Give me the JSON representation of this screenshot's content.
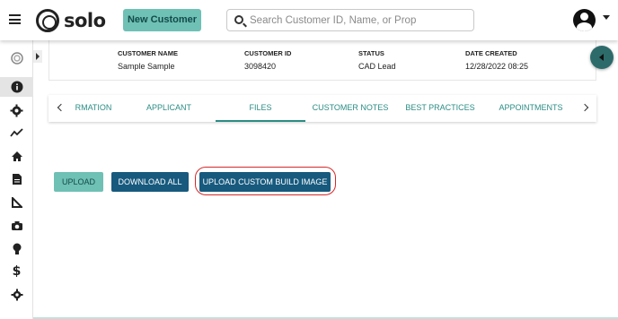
{
  "header": {
    "logo_text": "solo",
    "new_customer_label": "New Customer",
    "search_placeholder": "Search Customer ID, Name, or Prop",
    "search_value": ""
  },
  "sidebar": {
    "items": [
      {
        "icon": "target-icon"
      },
      {
        "icon": "info-icon",
        "active": true
      },
      {
        "icon": "gear-brain-icon"
      },
      {
        "icon": "trend-line-icon"
      },
      {
        "icon": "home-icon"
      },
      {
        "icon": "document-icon"
      },
      {
        "icon": "ruler-triangle-icon"
      },
      {
        "icon": "camera-icon"
      },
      {
        "icon": "lightbulb-icon"
      },
      {
        "icon": "dollar-icon"
      },
      {
        "icon": "settings-icon"
      }
    ]
  },
  "customer": {
    "name_label": "CUSTOMER NAME",
    "name_value": "Sample Sample",
    "id_label": "CUSTOMER ID",
    "id_value": "3098420",
    "status_label": "STATUS",
    "status_value": "CAD Lead",
    "date_label": "DATE CREATED",
    "date_value": "12/28/2022 08:25"
  },
  "tabs": [
    {
      "label": "RMATION"
    },
    {
      "label": "APPLICANT"
    },
    {
      "label": "FILES",
      "active": true
    },
    {
      "label": "CUSTOMER NOTES"
    },
    {
      "label": "BEST PRACTICES"
    },
    {
      "label": "APPOINTMENTS"
    }
  ],
  "files": {
    "upload_label": "UPLOAD",
    "download_all_label": "DOWNLOAD ALL",
    "upload_custom_label": "UPLOAD CUSTOM BUILD IMAGE"
  },
  "colors": {
    "teal_button": "#6fc0b5",
    "navy_button": "#175a7e",
    "tab_text": "#2b8d85",
    "highlight": "#d62828"
  }
}
